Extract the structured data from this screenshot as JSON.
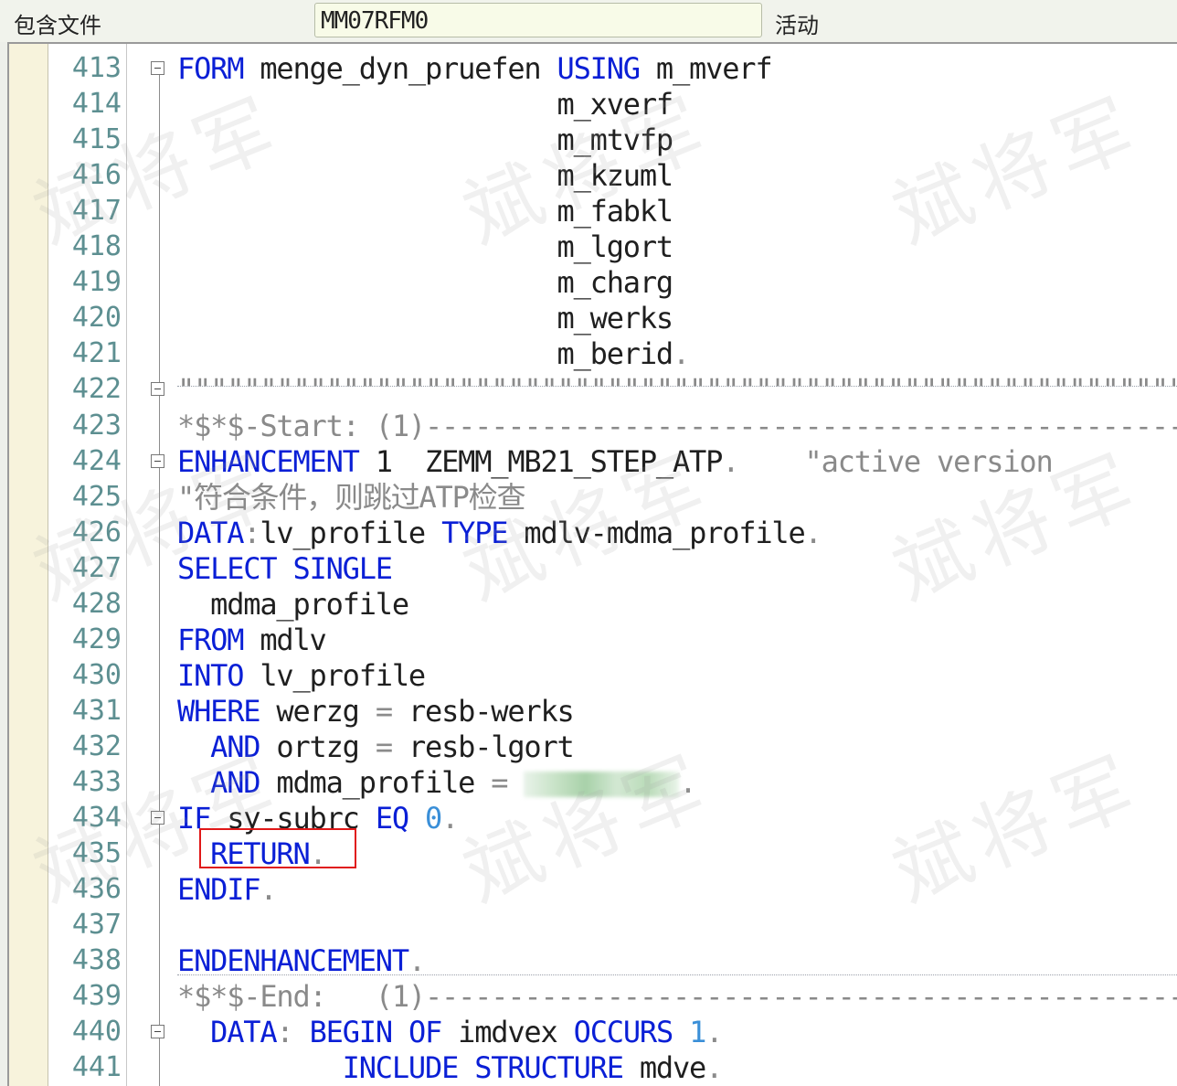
{
  "header": {
    "package_label": "包含文件",
    "program_name": "MM07RFM0",
    "status_label": "活动"
  },
  "watermark": "斌将军",
  "editor": {
    "lines": [
      {
        "num": "413",
        "fold": true,
        "segs": [
          [
            "kw",
            "FORM"
          ],
          [
            "t",
            " menge_dyn_pruefen "
          ],
          [
            "kw",
            "USING"
          ],
          [
            "t",
            " m_mverf"
          ]
        ]
      },
      {
        "num": "414",
        "fold": false,
        "segs": [
          [
            "t",
            "                       m_xverf"
          ]
        ]
      },
      {
        "num": "415",
        "fold": false,
        "segs": [
          [
            "t",
            "                       m_mtvfp"
          ]
        ]
      },
      {
        "num": "416",
        "fold": false,
        "segs": [
          [
            "t",
            "                       m_kzuml"
          ]
        ]
      },
      {
        "num": "417",
        "fold": false,
        "segs": [
          [
            "t",
            "                       m_fabkl"
          ]
        ]
      },
      {
        "num": "418",
        "fold": false,
        "segs": [
          [
            "t",
            "                       m_lgort"
          ]
        ]
      },
      {
        "num": "419",
        "fold": false,
        "segs": [
          [
            "t",
            "                       m_charg"
          ]
        ]
      },
      {
        "num": "420",
        "fold": false,
        "segs": [
          [
            "t",
            "                       m_werks"
          ]
        ]
      },
      {
        "num": "421",
        "fold": false,
        "segs": [
          [
            "t",
            "                       m_berid"
          ],
          [
            "op",
            "."
          ]
        ]
      },
      {
        "num": "422",
        "fold": true,
        "segs": [
          [
            "cm",
            "\"\"\"\"\"\"\"\"\"\"\"\"\"\"\"\"\"\"\"\"\"\"\"\"\"\"\"\"\"\"\"\"\"\"\"\"\"\"\"\"\"\"\"\"\"\"\"\"\"\"\"\"\"\"\"\"\"\"\"\"\"\"\"\"\"\"\"\""
          ]
        ]
      },
      {
        "num": "423",
        "fold": false,
        "segs": [
          [
            "cm",
            "*$*$-Start: (1)--------------------------------------------------"
          ]
        ]
      },
      {
        "num": "424",
        "fold": true,
        "segs": [
          [
            "kw",
            "ENHANCEMENT"
          ],
          [
            "t",
            " 1  ZEMM_MB21_STEP_ATP"
          ],
          [
            "op",
            "."
          ],
          [
            "cm",
            "    \"active version"
          ]
        ]
      },
      {
        "num": "425",
        "fold": false,
        "segs": [
          [
            "cm",
            "\"符合条件，则跳过ATP检查"
          ]
        ]
      },
      {
        "num": "426",
        "fold": false,
        "segs": [
          [
            "kw",
            "DATA"
          ],
          [
            "op",
            ":"
          ],
          [
            "t",
            "lv_profile "
          ],
          [
            "kw",
            "TYPE"
          ],
          [
            "t",
            " mdlv-mdma_profile"
          ],
          [
            "op",
            "."
          ]
        ]
      },
      {
        "num": "427",
        "fold": false,
        "segs": [
          [
            "kw",
            "SELECT SINGLE"
          ]
        ]
      },
      {
        "num": "428",
        "fold": false,
        "segs": [
          [
            "t",
            "  mdma_profile"
          ]
        ]
      },
      {
        "num": "429",
        "fold": false,
        "segs": [
          [
            "kw",
            "FROM"
          ],
          [
            "t",
            " mdlv"
          ]
        ]
      },
      {
        "num": "430",
        "fold": false,
        "segs": [
          [
            "kw",
            "INTO"
          ],
          [
            "t",
            " lv_profile"
          ]
        ]
      },
      {
        "num": "431",
        "fold": false,
        "segs": [
          [
            "kw",
            "WHERE"
          ],
          [
            "t",
            " werzg "
          ],
          [
            "op",
            "="
          ],
          [
            "t",
            " resb-werks"
          ]
        ]
      },
      {
        "num": "432",
        "fold": false,
        "segs": [
          [
            "t",
            "  "
          ],
          [
            "kw",
            "AND"
          ],
          [
            "t",
            " ortzg "
          ],
          [
            "op",
            "="
          ],
          [
            "t",
            " resb-lgort"
          ]
        ]
      },
      {
        "num": "433",
        "fold": false,
        "segs": [
          [
            "t",
            "  "
          ],
          [
            "kw",
            "AND"
          ],
          [
            "t",
            " mdma_profile "
          ],
          [
            "op",
            "="
          ],
          [
            "t",
            " "
          ],
          [
            "blur",
            ""
          ],
          [
            "op",
            "."
          ]
        ]
      },
      {
        "num": "434",
        "fold": true,
        "segs": [
          [
            "kw",
            "IF"
          ],
          [
            "t",
            " sy-subrc "
          ],
          [
            "kw",
            "EQ"
          ],
          [
            "t",
            " "
          ],
          [
            "num",
            "0"
          ],
          [
            "op",
            "."
          ]
        ]
      },
      {
        "num": "435",
        "fold": false,
        "segs": [
          [
            "t",
            "  "
          ],
          [
            "kw",
            "RETURN"
          ],
          [
            "op",
            "."
          ]
        ]
      },
      {
        "num": "436",
        "fold": false,
        "segs": [
          [
            "kw",
            "ENDIF"
          ],
          [
            "op",
            "."
          ]
        ]
      },
      {
        "num": "437",
        "fold": false,
        "segs": []
      },
      {
        "num": "438",
        "fold": false,
        "segs": [
          [
            "kw",
            "ENDENHANCEMENT"
          ],
          [
            "op",
            "."
          ]
        ]
      },
      {
        "num": "439",
        "fold": false,
        "segs": [
          [
            "cm",
            "*$*$-End:   (1)--------------------------------------------------"
          ]
        ]
      },
      {
        "num": "440",
        "fold": true,
        "segs": [
          [
            "t",
            "  "
          ],
          [
            "kw",
            "DATA"
          ],
          [
            "op",
            ":"
          ],
          [
            "t",
            " "
          ],
          [
            "kw",
            "BEGIN OF"
          ],
          [
            "t",
            " imdvex "
          ],
          [
            "kw",
            "OCCURS"
          ],
          [
            "t",
            " "
          ],
          [
            "num",
            "1"
          ],
          [
            "op",
            "."
          ]
        ]
      },
      {
        "num": "441",
        "fold": false,
        "segs": [
          [
            "t",
            "          "
          ],
          [
            "kw",
            "INCLUDE STRUCTURE"
          ],
          [
            "t",
            " mdve"
          ],
          [
            "op",
            "."
          ]
        ]
      }
    ]
  }
}
